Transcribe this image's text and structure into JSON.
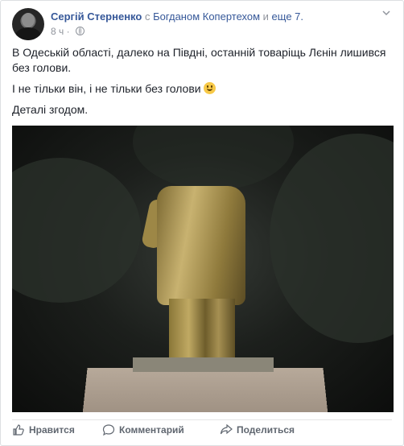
{
  "post": {
    "author": "Сергій Стерненко",
    "connector": " с ",
    "tagged": "Богданом Копертехом",
    "and": " и ",
    "others": "еще 7.",
    "time": "8 ч · ",
    "paragraphs": [
      "В Одеській області, далеко на Півдні, останній товаріщь Лєнін лишився без голови.",
      "І не тільки він, і не тільки без голови",
      "Деталі згодом."
    ]
  },
  "actions": {
    "like": "Нравится",
    "comment": "Комментарий",
    "share": "Поделиться"
  },
  "icons": {
    "globe": "globe-icon",
    "chevron": "chevron-down-icon",
    "like": "thumbs-up-icon",
    "comment": "comment-bubble-icon",
    "share": "share-arrow-icon",
    "emoji": "smiley-emoji"
  },
  "colors": {
    "link": "#365899",
    "meta": "#90949c",
    "action": "#606770"
  }
}
